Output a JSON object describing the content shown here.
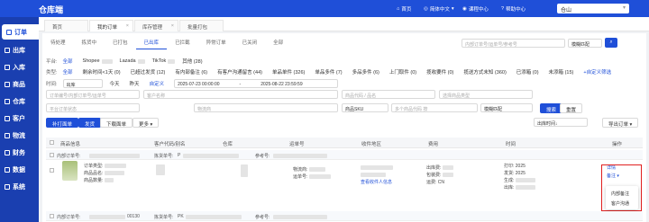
{
  "app": {
    "title": "仓库端",
    "nav": {
      "home": "首页",
      "courses": "课程中心",
      "help": "帮助中心",
      "lang": "简体中文"
    },
    "warehouse": "仓山"
  },
  "sidebar": [
    "订单",
    "出库",
    "入库",
    "商品",
    "仓库",
    "客户",
    "物流",
    "财务",
    "数据",
    "系统"
  ],
  "tabs": [
    {
      "label": "首页"
    },
    {
      "label": "我的订单"
    },
    {
      "label": "库存管理"
    },
    {
      "label": "批量打包"
    }
  ],
  "status_tabs": [
    "待处理",
    "拣货中",
    "已打包",
    "已出库",
    "已拦截",
    "异常订单",
    "已关闭",
    "全部"
  ],
  "search": {
    "placeholder": "内部订单号/运单号/参考号",
    "match": "模糊匹配"
  },
  "filters": {
    "platform": {
      "label": "平台:",
      "options": [
        "全部",
        "Shopee",
        "Lazada",
        "TikTok",
        "其他 (28)"
      ]
    },
    "type": {
      "label": "类型:",
      "options": [
        "全部",
        "剩余时间<1天 (0)",
        "已超过发货 (12)",
        "有内部备注 (6)",
        "有客户沟通留言 (44)",
        "单品单件 (326)",
        "单品多件 (7)",
        "多品多件 (6)",
        "上门取件 (0)",
        "揽收要件 (0)",
        "揽送方式未知 (360)",
        "已添箱 (0)",
        "未添箱 (15)",
        "+自定义筛选"
      ]
    },
    "time": {
      "label": "时间:",
      "field": "出库",
      "shortcuts": [
        "今天",
        "昨天",
        "自定义"
      ],
      "start": "2025-07-23 00:00:00",
      "end": "2025-08-22 23:59:59"
    }
  },
  "inputs": {
    "order_no": "订单编号/内部订单号/运单号",
    "customer": "客户名称",
    "product": "商品代码 / 品名",
    "product_type": "选择商品类型",
    "platform_shop": "平台订单状态",
    "logistics": "物流商",
    "sku_field": "商品SKU",
    "sku_search": "多个商品代码 按 ",
    "fuzzy": "模糊匹配",
    "search_btn": "搜索",
    "reset_btn": "重置"
  },
  "actions": {
    "batch_print": "补打面单",
    "ship": "发货",
    "download": "下载面单",
    "more": "更多",
    "sort": "出库时间↓",
    "export": "导出订单"
  },
  "table": {
    "headers": [
      "商品信息",
      "客户代码/别名",
      "仓库",
      "运单号",
      "收件地区",
      "费用",
      "时间",
      "操作"
    ]
  },
  "orders": [
    {
      "inner_no_label": "内部订单号:",
      "inner_no": "",
      "pick_no_label": "拣货单号:",
      "pick_no": "P",
      "ref_label": "参考号:"
    },
    {
      "inner_no_label": "内部订单号:",
      "inner_no": "00130",
      "pick_no_label": "拣货单号:",
      "pick_no": "PK",
      "ref_label": "参考号:"
    }
  ],
  "order_row": {
    "lines": [
      "订单类型:",
      "商品品名:",
      "商品数量:"
    ],
    "logistics": "物流商:",
    "tracking": "运单号:",
    "view_receiver": "查看收件人信息",
    "fees": [
      "出库费:",
      "包装费:",
      "运费:"
    ],
    "fee_cur": "CN",
    "times": [
      "打印:",
      "发货:",
      "生成:",
      "出库:"
    ],
    "time_prefix": "2025",
    "details": "详情",
    "remark": "备注"
  },
  "dropdown": [
    "内部备注",
    "客户沟通"
  ]
}
